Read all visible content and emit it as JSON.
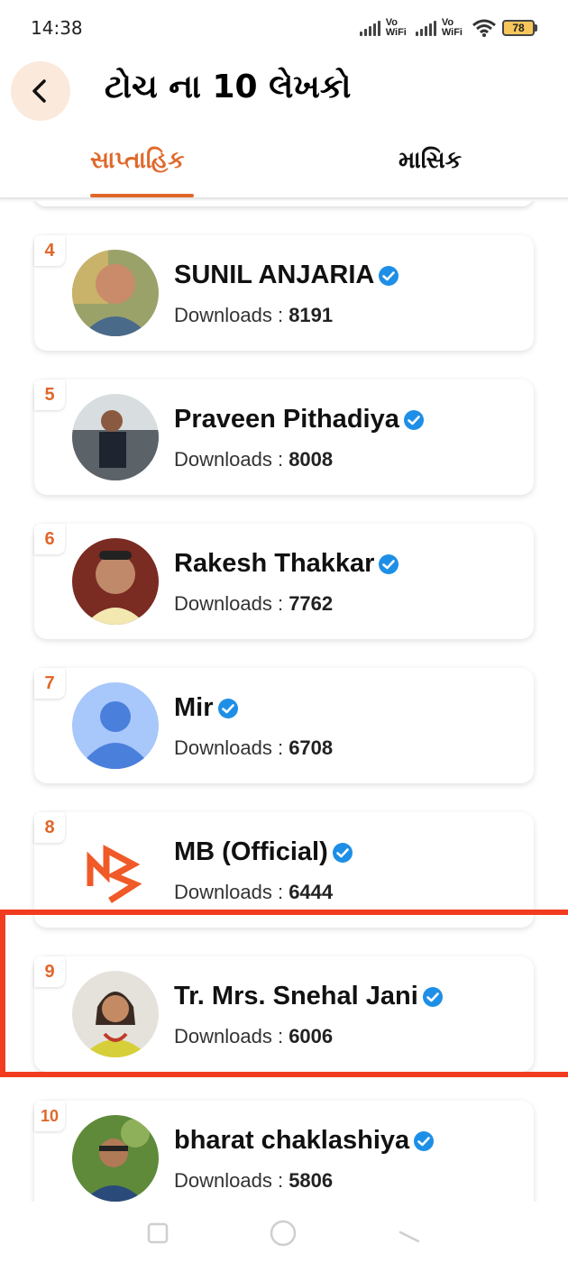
{
  "status_bar": {
    "time": "14:38",
    "vowifi_1": [
      "Vo",
      "WiFi"
    ],
    "vowifi_2": [
      "Vo",
      "WiFi"
    ],
    "battery": "78"
  },
  "header": {
    "title": "ટોચ ના 10 લેખકો",
    "back_icon": "chevron-left-icon"
  },
  "tabs": [
    {
      "label": "સાપ્તાહિક",
      "active": true
    },
    {
      "label": "માસિક",
      "active": false
    }
  ],
  "colors": {
    "accent": "#e0672a",
    "highlight": "#f23c1f",
    "verified": "#1e8fe6"
  },
  "writers": [
    {
      "rank": "4",
      "name": "SUNIL ANJARIA",
      "downloads_label": "Downloads : ",
      "downloads": "8191",
      "avatar": "photo"
    },
    {
      "rank": "5",
      "name": "Praveen Pithadiya",
      "downloads_label": "Downloads : ",
      "downloads": "8008",
      "avatar": "photo"
    },
    {
      "rank": "6",
      "name": "Rakesh Thakkar",
      "downloads_label": "Downloads : ",
      "downloads": "7762",
      "avatar": "photo"
    },
    {
      "rank": "7",
      "name": "Mir",
      "downloads_label": "Downloads : ",
      "downloads": "6708",
      "avatar": "default-user"
    },
    {
      "rank": "8",
      "name": "MB (Official)",
      "downloads_label": "Downloads : ",
      "downloads": "6444",
      "avatar": "mb-logo"
    },
    {
      "rank": "9",
      "name": "Tr. Mrs. Snehal Jani",
      "downloads_label": "Downloads : ",
      "downloads": "6006",
      "avatar": "photo"
    },
    {
      "rank": "10",
      "name": "bharat chaklashiya",
      "downloads_label": "Downloads : ",
      "downloads": "5806",
      "avatar": "photo"
    }
  ]
}
